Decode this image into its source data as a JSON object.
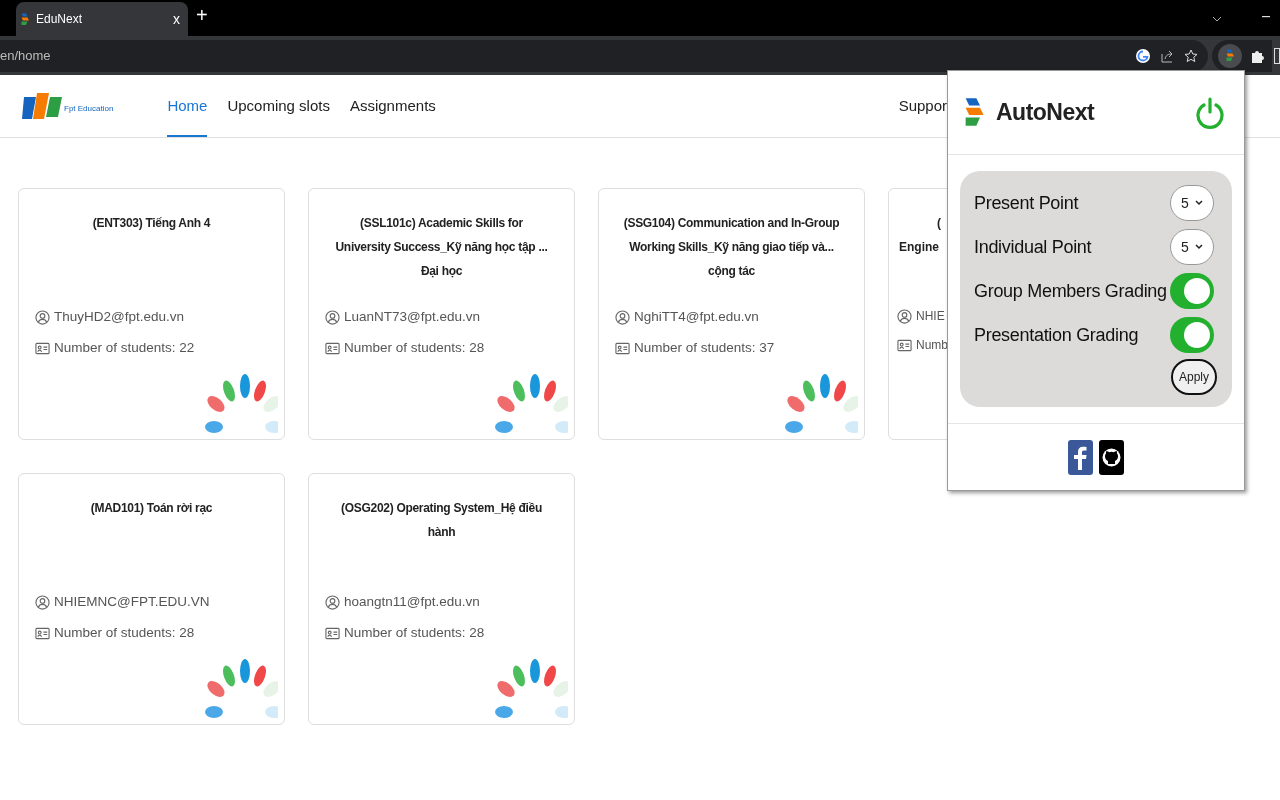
{
  "browser": {
    "tab_title": "EduNext",
    "tab_close": "x",
    "new_tab": "+",
    "address": "en/home"
  },
  "site": {
    "logo_text": "Fpt Education",
    "nav": [
      {
        "label": "Home",
        "selected": true
      },
      {
        "label": "Upcoming slots",
        "selected": false
      },
      {
        "label": "Assignments",
        "selected": false
      }
    ],
    "support_link": "Suppor"
  },
  "courses": [
    {
      "title_lines": [
        "(ENT303) Tiếng Anh 4"
      ],
      "email": "ThuyHD2@fpt.edu.vn",
      "students": "Number of students: 22",
      "cut_by_popup": false
    },
    {
      "title_lines": [
        "(SSL101c) Academic Skills for",
        "University Success_Kỹ năng học tập ...",
        "Đại học"
      ],
      "email": "LuanNT73@fpt.edu.vn",
      "students": "Number of students: 28",
      "cut_by_popup": false
    },
    {
      "title_lines": [
        "(SSG104) Communication and In-Group",
        "Working Skills_Kỹ năng giao tiếp và...",
        "cộng tác"
      ],
      "email": "NghiTT4@fpt.edu.vn",
      "students": "Number of students: 37",
      "cut_by_popup": false
    },
    {
      "title_lines": [
        "(",
        "Engine"
      ],
      "email": "NHIE",
      "students": "Numb",
      "cut_by_popup": true
    },
    {
      "title_lines": [
        "(MAD101) Toán rời rạc"
      ],
      "email": "NHIEMNC@FPT.EDU.VN",
      "students": "Number of students: 28",
      "cut_by_popup": false
    },
    {
      "title_lines": [
        "(OSG202) Operating System_Hệ điều",
        "hành"
      ],
      "email": "hoangtn11@fpt.edu.vn",
      "students": "Number of students: 28",
      "cut_by_popup": false
    }
  ],
  "popup": {
    "title": "AutoNext",
    "power_on": true,
    "settings": [
      {
        "kind": "select",
        "label": "Present Point",
        "value": "5"
      },
      {
        "kind": "select",
        "label": "Individual Point",
        "value": "5"
      },
      {
        "kind": "toggle",
        "label": "Group Members Grading",
        "on": true
      },
      {
        "kind": "toggle",
        "label": "Presentation Grading",
        "on": true
      }
    ],
    "apply_button": "Apply"
  }
}
